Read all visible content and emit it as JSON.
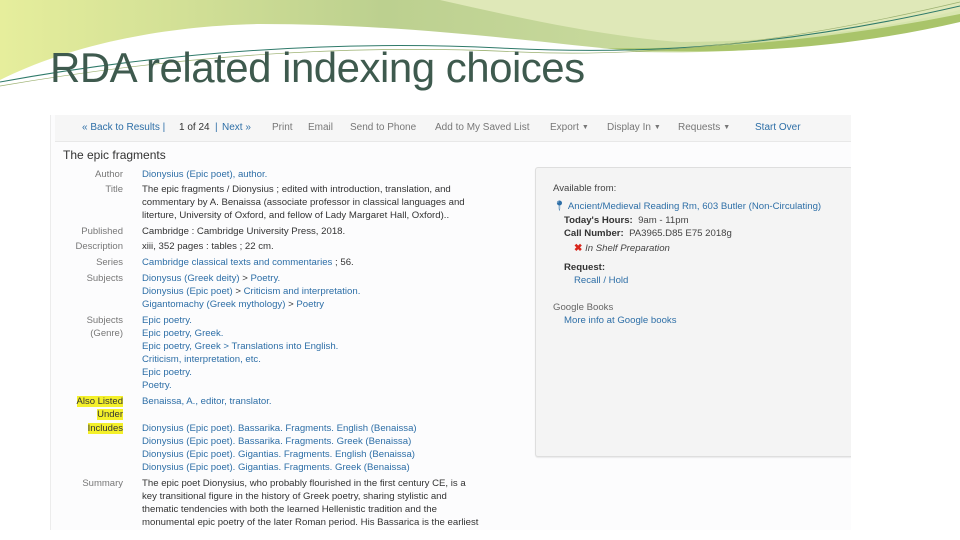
{
  "slide": {
    "title": "RDA related indexing choices",
    "accent_colors": {
      "title": "#3e5a4e",
      "swoosh_light": "#dfe8b8",
      "swoosh_dark": "#a9c46a",
      "line": "#2f7a6a"
    }
  },
  "toolbar": {
    "back": "« Back to Results |",
    "position": "1 of 24",
    "sep": "|",
    "next": "Next »",
    "print": "Print",
    "email": "Email",
    "send_to_phone": "Send to Phone",
    "add_to_list": "Add to My Saved List",
    "export": "Export",
    "display_in": "Display In",
    "requests": "Requests",
    "start_over": "Start Over",
    "caret": "▼"
  },
  "record": {
    "title": "The epic fragments",
    "fields": {
      "author_label": "Author",
      "author": "Dionysius (Epic poet), author.",
      "title_label": "Title",
      "title_lines": [
        "The epic fragments / Dionysius ; edited with introduction, translation, and",
        "commentary by A. Benaissa (associate professor in classical languages and",
        "literture, University of Oxford, and fellow of Lady Margaret Hall, Oxford).."
      ],
      "published_label": "Published",
      "published": "Cambridge : Cambridge University Press, 2018.",
      "description_label": "Description",
      "description": "xiii, 352 pages : tables ; 22 cm.",
      "series_label": "Series",
      "series_link": "Cambridge classical texts and commentaries",
      "series_suffix": " ; 56.",
      "subjects_label": "Subjects",
      "subjects": [
        {
          "main": "Dionysus (Greek deity)",
          "sub": "Poetry."
        },
        {
          "main": "Dionysius (Epic poet)",
          "sub": "Criticism and interpretation."
        },
        {
          "main": "Gigantomachy (Greek mythology)",
          "sub": "Poetry"
        }
      ],
      "genre_label_1": "Subjects",
      "genre_label_2": "(Genre)",
      "genres": [
        "Epic poetry.",
        "Epic poetry, Greek.",
        "Epic poetry, Greek > Translations into English.",
        "Criticism, interpretation, etc.",
        "Epic poetry.",
        "Poetry."
      ],
      "also_listed_label_1": "Also Listed",
      "also_listed_label_2": "Under",
      "also_listed": "Benaissa, A., editor, translator.",
      "includes_label": "Includes",
      "includes": [
        "Dionysius (Epic poet). Bassarika. Fragments. English (Benaissa)",
        "Dionysius (Epic poet). Bassarika. Fragments. Greek (Benaissa)",
        "Dionysius (Epic poet). Gigantias. Fragments. English (Benaissa)",
        "Dionysius (Epic poet). Gigantias. Fragments. Greek (Benaissa)"
      ],
      "summary_label": "Summary",
      "summary_lines": [
        "The epic poet Dionysius, who probably flourished in the first century CE, is a",
        "key transitional figure in the history of Greek poetry, sharing stylistic and",
        "thematic tendencies with both the learned Hellenistic tradition and the",
        "monumental epic poetry of the later Roman period. His Bassarica is the earliest"
      ]
    }
  },
  "availability": {
    "heading": "Available from:",
    "location": "Ancient/Medieval Reading Rm, 603 Butler (Non-Circulating)",
    "hours_label": "Today's Hours:",
    "hours": "9am - 11pm",
    "call_label": "Call Number:",
    "call_number": "PA3965.D85 E75 2018g",
    "status": "In Shelf Preparation",
    "request_label": "Request:",
    "request_link": "Recall / Hold",
    "google_heading": "Google Books",
    "google_link": "More info at Google books"
  }
}
